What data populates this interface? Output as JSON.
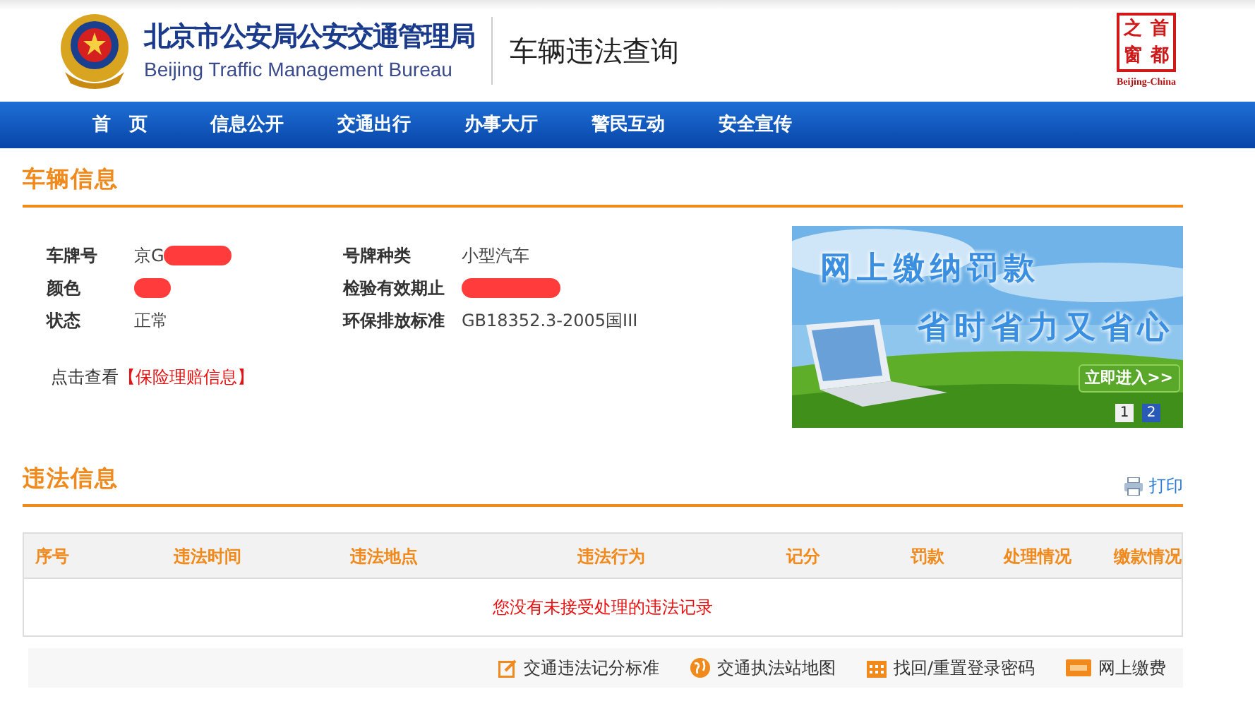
{
  "header": {
    "org_name": "北京市公安局公安交通管理局",
    "org_name_en": "Beijing Traffic Management Bureau",
    "page_title": "车辆违法查询",
    "badge": {
      "chars": [
        "之",
        "首",
        "窗",
        "都"
      ],
      "caption": "Beijing-China"
    }
  },
  "nav": [
    {
      "label": "首　页",
      "selected": false
    },
    {
      "label": "信息公开",
      "selected": false
    },
    {
      "label": "交通出行",
      "selected": false
    },
    {
      "label": "办事大厅",
      "selected": false
    },
    {
      "label": "警民互动",
      "selected": false
    },
    {
      "label": "安全宣传",
      "selected": false
    }
  ],
  "vehicle_info": {
    "title": "车辆信息",
    "fields": [
      {
        "label": "车牌号",
        "value": "京G",
        "redacted": true
      },
      {
        "label": "号牌种类",
        "value": "小型汽车"
      },
      {
        "label": "颜色",
        "redacted": true
      },
      {
        "label": "检验有效期止",
        "redacted": true
      },
      {
        "label": "状态",
        "value": "正常"
      },
      {
        "label": "环保排放标准",
        "value": "GB18352.3-2005国III"
      }
    ],
    "insurance": {
      "prefix": "点击查看",
      "link": "【保险理赔信息】"
    }
  },
  "banner": {
    "line_1": "网上缴纳罚款",
    "line_2": "省时省力又省心",
    "enter_button": "立即进入>>",
    "pages": [
      {
        "label": "1",
        "selected": false
      },
      {
        "label": "2",
        "selected": true
      }
    ]
  },
  "violations": {
    "title": "违法信息",
    "print": "打印",
    "columns": [
      "序号",
      "违法时间",
      "违法地点",
      "违法行为",
      "记分",
      "罚款",
      "处理情况",
      "缴款情况"
    ],
    "empty_message": "您没有未接受处理的违法记录"
  },
  "footer_links": [
    {
      "label": "交通违法记分标准",
      "kind": "edit"
    },
    {
      "label": "交通执法站地图",
      "kind": "globe"
    },
    {
      "label": "找回/重置登录密码",
      "kind": "calendar"
    },
    {
      "label": "网上缴费",
      "kind": "card"
    }
  ]
}
